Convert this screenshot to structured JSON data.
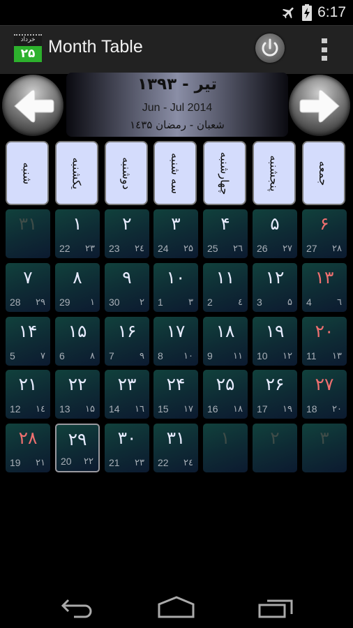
{
  "status_bar": {
    "time": "6:17",
    "icons": [
      "airplane-mode-icon",
      "battery-charging-icon"
    ]
  },
  "action_bar": {
    "app_icon": {
      "month_label": "خرداد",
      "day": "۲۵"
    },
    "title": "Month Table",
    "power_button": "power-icon",
    "overflow_menu": "overflow-menu-icon"
  },
  "header": {
    "persian_month": "تیر - ۱۳۹۳",
    "gregorian_range": "Jun - Jul 2014",
    "hijri_range": "شعبان  - رمضان ۱٤۳۵",
    "prev_button": "arrow-left-icon",
    "next_button": "arrow-right-icon"
  },
  "weekdays": [
    "شنبه",
    "یکشنبه",
    "دوشنبه",
    "سه شنبه",
    "چهارشنبه",
    "پنجشنبه",
    "جمعه"
  ],
  "colors": {
    "holiday": "#f07070",
    "day_text": "#e8ecff",
    "weekday_bg": "#d4dcfc",
    "app_icon_green": "#2db12d"
  },
  "weeks": [
    [
      {
        "p": "۳۱",
        "g": "",
        "h": "",
        "state": "dim"
      },
      {
        "p": "۱",
        "g": "22",
        "h": "۲۳",
        "state": ""
      },
      {
        "p": "۲",
        "g": "23",
        "h": "۲٤",
        "state": ""
      },
      {
        "p": "۳",
        "g": "24",
        "h": "۲۵",
        "state": ""
      },
      {
        "p": "۴",
        "g": "25",
        "h": "۲٦",
        "state": ""
      },
      {
        "p": "۵",
        "g": "26",
        "h": "۲۷",
        "state": ""
      },
      {
        "p": "۶",
        "g": "27",
        "h": "۲۸",
        "state": "holiday"
      }
    ],
    [
      {
        "p": "۷",
        "g": "28",
        "h": "۲۹",
        "state": ""
      },
      {
        "p": "۸",
        "g": "29",
        "h": "۱",
        "state": ""
      },
      {
        "p": "۹",
        "g": "30",
        "h": "۲",
        "state": ""
      },
      {
        "p": "۱۰",
        "g": "1",
        "h": "۳",
        "state": ""
      },
      {
        "p": "۱۱",
        "g": "2",
        "h": "٤",
        "state": ""
      },
      {
        "p": "۱۲",
        "g": "3",
        "h": "۵",
        "state": ""
      },
      {
        "p": "۱۳",
        "g": "4",
        "h": "٦",
        "state": "holiday"
      }
    ],
    [
      {
        "p": "۱۴",
        "g": "5",
        "h": "۷",
        "state": ""
      },
      {
        "p": "۱۵",
        "g": "6",
        "h": "۸",
        "state": ""
      },
      {
        "p": "۱۶",
        "g": "7",
        "h": "۹",
        "state": ""
      },
      {
        "p": "۱۷",
        "g": "8",
        "h": "۱۰",
        "state": ""
      },
      {
        "p": "۱۸",
        "g": "9",
        "h": "۱۱",
        "state": ""
      },
      {
        "p": "۱۹",
        "g": "10",
        "h": "۱۲",
        "state": ""
      },
      {
        "p": "۲۰",
        "g": "11",
        "h": "۱۳",
        "state": "holiday"
      }
    ],
    [
      {
        "p": "۲۱",
        "g": "12",
        "h": "۱٤",
        "state": ""
      },
      {
        "p": "۲۲",
        "g": "13",
        "h": "۱۵",
        "state": ""
      },
      {
        "p": "۲۳",
        "g": "14",
        "h": "۱٦",
        "state": ""
      },
      {
        "p": "۲۴",
        "g": "15",
        "h": "۱۷",
        "state": ""
      },
      {
        "p": "۲۵",
        "g": "16",
        "h": "۱۸",
        "state": ""
      },
      {
        "p": "۲۶",
        "g": "17",
        "h": "۱۹",
        "state": ""
      },
      {
        "p": "۲۷",
        "g": "18",
        "h": "۲۰",
        "state": "holiday"
      }
    ],
    [
      {
        "p": "۲۸",
        "g": "19",
        "h": "۲۱",
        "state": "holiday"
      },
      {
        "p": "۲۹",
        "g": "20",
        "h": "۲۲",
        "state": "today"
      },
      {
        "p": "۳۰",
        "g": "21",
        "h": "۲۳",
        "state": ""
      },
      {
        "p": "۳۱",
        "g": "22",
        "h": "۲٤",
        "state": ""
      },
      {
        "p": "۱",
        "g": "",
        "h": "",
        "state": "dim"
      },
      {
        "p": "۲",
        "g": "",
        "h": "",
        "state": "dim"
      },
      {
        "p": "۳",
        "g": "",
        "h": "",
        "state": "dim"
      }
    ]
  ],
  "nav_bar": [
    "back-icon",
    "home-icon",
    "recent-apps-icon"
  ]
}
